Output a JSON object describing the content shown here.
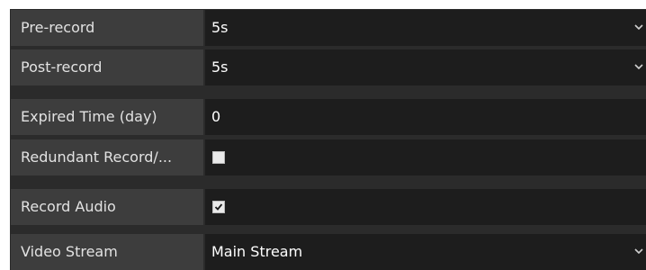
{
  "rows": [
    {
      "label": "Pre-record",
      "value": "5s",
      "type": "dropdown"
    },
    {
      "label": "Post-record",
      "value": "5s",
      "type": "dropdown"
    },
    {
      "label": "Expired Time (day)",
      "value": "0",
      "type": "text"
    },
    {
      "label": "Redundant Record/...",
      "checked": false,
      "type": "checkbox"
    },
    {
      "label": "Record Audio",
      "checked": true,
      "type": "checkbox"
    },
    {
      "label": "Video Stream",
      "value": "Main Stream",
      "type": "dropdown"
    }
  ],
  "icons": {
    "dropdown": "chevron-down-icon",
    "checked": "check-icon"
  }
}
